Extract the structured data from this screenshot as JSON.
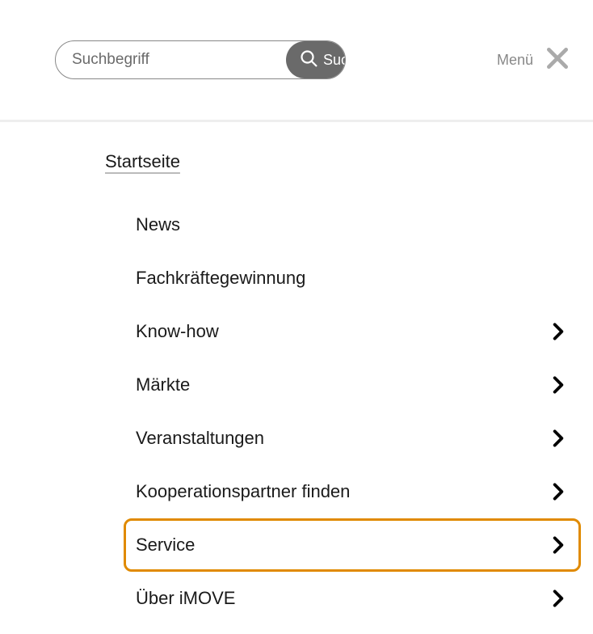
{
  "search": {
    "placeholder": "Suchbegriff",
    "button_label": "Suchen"
  },
  "menu_label": "Menü",
  "home_label": "Startseite",
  "nav": {
    "items": [
      {
        "label": "News",
        "has_children": false,
        "highlighted": false
      },
      {
        "label": "Fachkräftegewinnung",
        "has_children": false,
        "highlighted": false
      },
      {
        "label": "Know-how",
        "has_children": true,
        "highlighted": false
      },
      {
        "label": "Märkte",
        "has_children": true,
        "highlighted": false
      },
      {
        "label": "Veranstaltungen",
        "has_children": true,
        "highlighted": false
      },
      {
        "label": "Kooperationspartner finden",
        "has_children": true,
        "highlighted": false
      },
      {
        "label": "Service",
        "has_children": true,
        "highlighted": true
      },
      {
        "label": "Über iMOVE",
        "has_children": true,
        "highlighted": false
      }
    ]
  }
}
